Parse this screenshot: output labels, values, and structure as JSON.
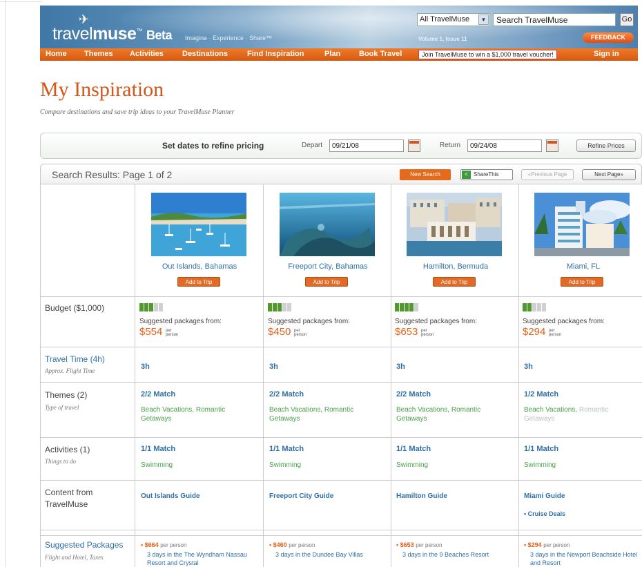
{
  "header": {
    "logo_prefix": "travel",
    "logo_bold": "muse",
    "logo_beta": "Beta",
    "tagline": "Imagine · Experience · Share™",
    "issue": "Volume 1, Issue 11",
    "site_select": "All TravelMuse",
    "search_value": "Search TravelMuse",
    "go_label": "Go",
    "feedback_label": "FEEDBACK"
  },
  "nav": {
    "items": [
      "Home",
      "Themes",
      "Activities",
      "Destinations",
      "Find Inspiration",
      "Plan",
      "Book Travel"
    ],
    "promo": "Join TravelMuse to win a $1,000 travel voucher!",
    "signin": "Sign in"
  },
  "page": {
    "title": "My Inspiration",
    "subtitle": "Compare destinations and save trip ideas to your TravelMuse Planner"
  },
  "dates": {
    "label": "Set dates to refine pricing",
    "depart_label": "Depart",
    "depart_value": "09/21/08",
    "return_label": "Return",
    "return_value": "09/24/08",
    "refine_label": "Refine Prices"
  },
  "results": {
    "label": "Search Results: Page 1 of 2",
    "new_search": "New Search",
    "share": "ShareThis",
    "prev": "«Previous Page",
    "next": "Next Page»"
  },
  "rows": {
    "budget": {
      "label": "Budget ($1,000)"
    },
    "travel_time": {
      "label": "Travel Time (4h)",
      "sub": "Approx. Flight Time"
    },
    "themes": {
      "label": "Themes (2)",
      "sub": "Type of travel"
    },
    "activities": {
      "label": "Activities (1)",
      "sub": "Things to do"
    },
    "content": {
      "label_line1": "Content from",
      "label_line2": "TravelMuse"
    },
    "packages": {
      "label": "Suggested Packages",
      "sub": "Flight and Hotel, Taxes"
    }
  },
  "common": {
    "add_to_trip": "Add to Trip",
    "suggested_from": "Suggested packages from:",
    "per_person_line1": "per",
    "per_person_line2": "person",
    "pkg_per_person": "per person"
  },
  "destinations": [
    {
      "name": "Out Islands, Bahamas",
      "budget_level": 3,
      "price": "$554",
      "travel_time": "3h",
      "theme_match": "2/2 Match",
      "themes_matched": "Beach Vacations, Romantic Getaways",
      "themes_unmatched": "",
      "activity_match": "1/1 Match",
      "activity": "Swimming",
      "guide": "Out Islands Guide",
      "cruise": "",
      "pkg_price": "$664",
      "pkg_desc": "3 days in the The Wyndham Nassau Resort and Crystal"
    },
    {
      "name": "Freeport City, Bahamas",
      "budget_level": 3,
      "price": "$450",
      "travel_time": "3h",
      "theme_match": "2/2 Match",
      "themes_matched": "Beach Vacations, Romantic Getaways",
      "themes_unmatched": "",
      "activity_match": "1/1 Match",
      "activity": "Swimming",
      "guide": "Freeport City Guide",
      "cruise": "",
      "pkg_price": "$460",
      "pkg_desc": "3 days in the Dundee Bay Villas"
    },
    {
      "name": "Hamilton, Bermuda",
      "budget_level": 4,
      "price": "$653",
      "travel_time": "3h",
      "theme_match": "2/2 Match",
      "themes_matched": "Beach Vacations, Romantic Getaways",
      "themes_unmatched": "",
      "activity_match": "1/1 Match",
      "activity": "Swimming",
      "guide": "Hamilton Guide",
      "cruise": "",
      "pkg_price": "$653",
      "pkg_desc": "3 days in the 9 Beaches Resort"
    },
    {
      "name": "Miami, FL",
      "budget_level": 2,
      "price": "$294",
      "travel_time": "3h",
      "theme_match": "1/2 Match",
      "themes_matched": "Beach Vacations,",
      "themes_unmatched": "Romantic Getaways",
      "activity_match": "1/1 Match",
      "activity": "Swimming",
      "guide": "Miami Guide",
      "cruise": "Cruise Deals",
      "pkg_price": "$294",
      "pkg_desc": "3 days in the Newport Beachside Hotel and Resort"
    }
  ],
  "colors": {
    "brand_orange": "#d4561a",
    "link_blue": "#2e6fa8",
    "match_green": "#4aa04a",
    "budget_green": "#4f9a2a",
    "header_blue": "#3f77a6"
  },
  "icons": [
    "plane-icon",
    "calendar-icon",
    "share-icon",
    "chevron-down-icon"
  ]
}
